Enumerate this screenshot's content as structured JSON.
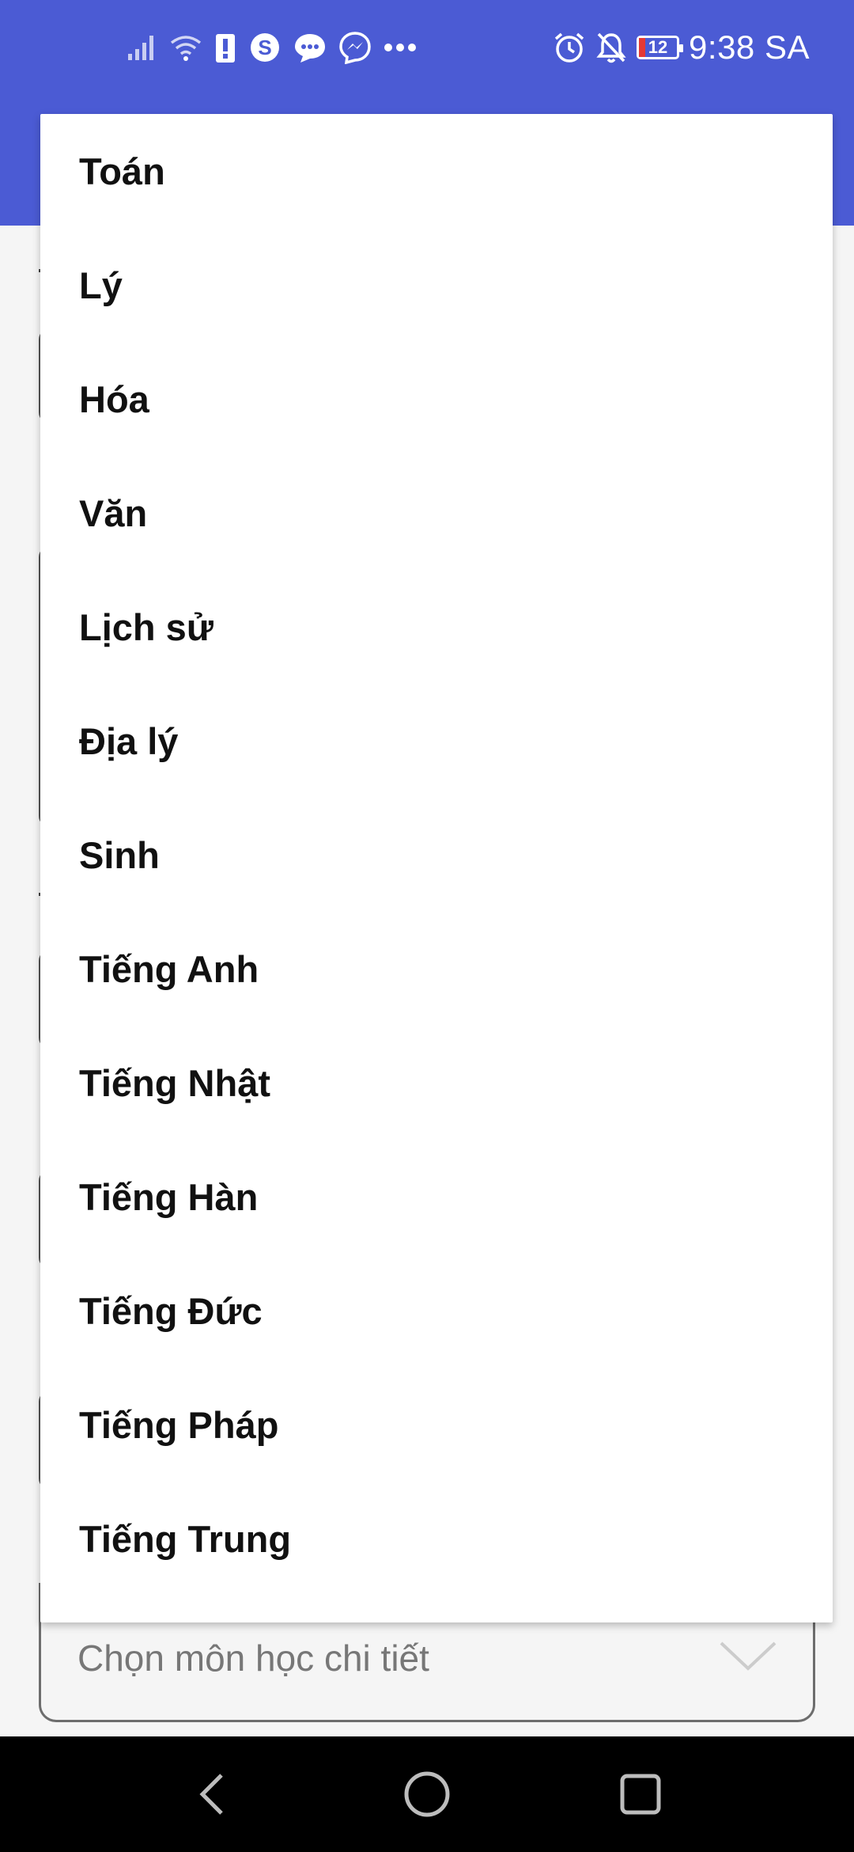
{
  "status_bar": {
    "time": "9:38 SA",
    "battery_level": "12",
    "left_icons": [
      "signal-icon",
      "wifi-icon",
      "alert-icon",
      "skype-icon",
      "chat-bubble-icon",
      "messenger-icon",
      "more-dots-icon"
    ],
    "right_icons": [
      "alarm-icon",
      "mute-bell-icon",
      "battery-icon"
    ]
  },
  "colors": {
    "app_bar": "#4b5bd4",
    "background": "#f5f5f5",
    "dropdown_bg": "#ffffff",
    "nav_bar": "#000000"
  },
  "dropdown": {
    "items": [
      "Toán",
      "Lý",
      "Hóa",
      "Văn",
      "Lịch sử",
      "Địa lý",
      "Sinh",
      "Tiếng Anh",
      "Tiếng Nhật",
      "Tiếng Hàn",
      "Tiếng Đức",
      "Tiếng Pháp",
      "Tiếng Trung"
    ]
  },
  "detail_select": {
    "placeholder": "Chọn môn học chi tiết"
  },
  "nav_bar": {
    "buttons": [
      "back-icon",
      "home-icon",
      "recents-icon"
    ]
  }
}
